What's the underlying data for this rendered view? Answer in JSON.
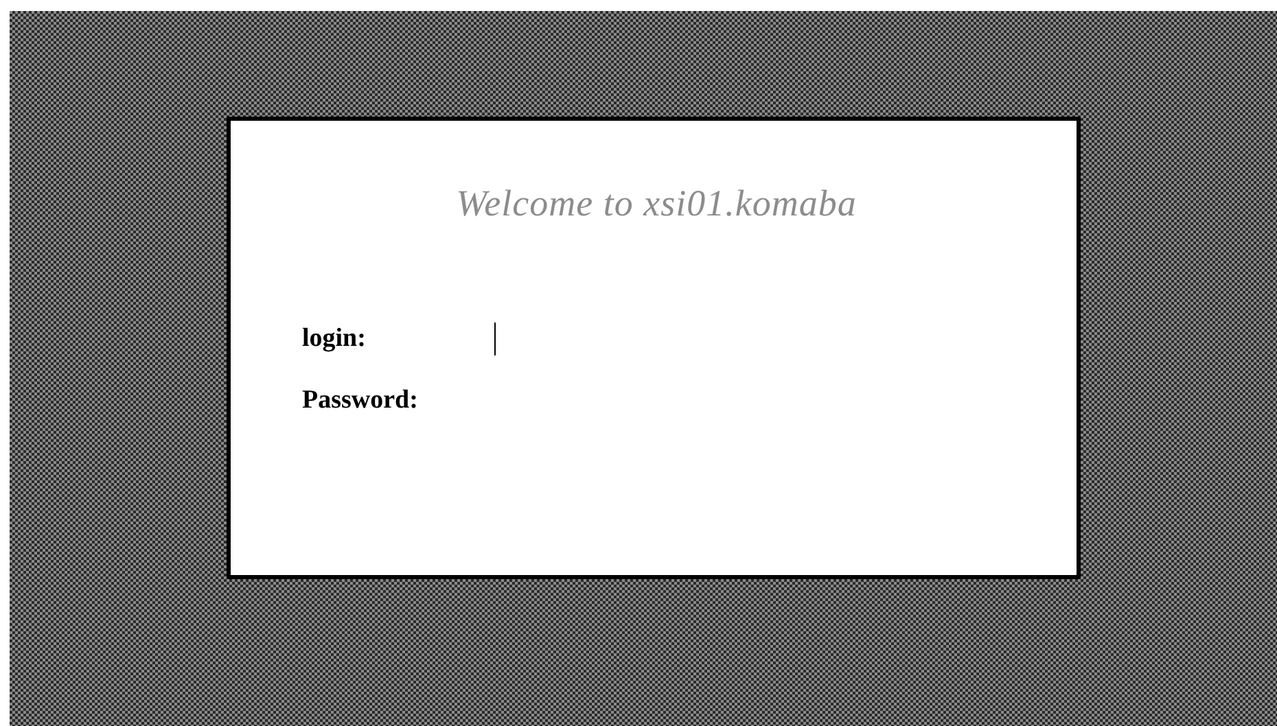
{
  "greeting": "Welcome to xsi01.komaba",
  "fields": [
    {
      "label": "login:",
      "focused": true
    },
    {
      "label": "Password:",
      "focused": false
    }
  ]
}
